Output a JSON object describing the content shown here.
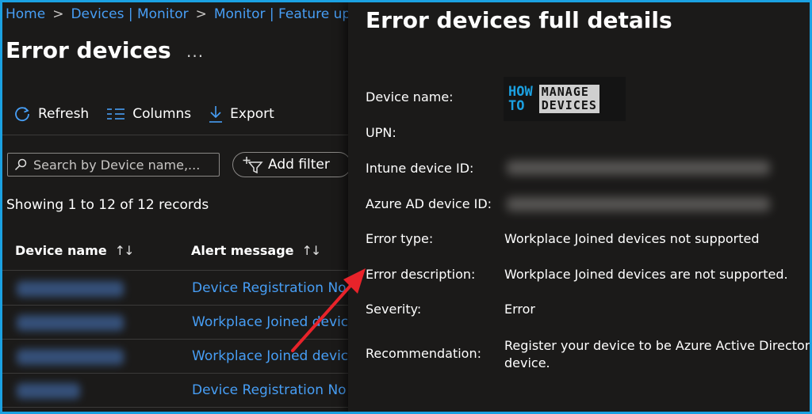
{
  "breadcrumb": {
    "items": [
      "Home",
      "Devices | Monitor",
      "Monitor | Feature up"
    ],
    "separator": ">"
  },
  "page": {
    "title": "Error devices",
    "more_label": "..."
  },
  "toolbar": {
    "refresh_label": "Refresh",
    "columns_label": "Columns",
    "export_label": "Export"
  },
  "search": {
    "placeholder": "Search by Device name,..."
  },
  "filter": {
    "add_filter_label": "Add filter"
  },
  "records": {
    "text": "Showing 1 to 12 of 12 records"
  },
  "table": {
    "columns": [
      "Device name",
      "Alert message"
    ],
    "sort_glyph": "↑↓",
    "rows": [
      {
        "alert_message": "Device Registration No T"
      },
      {
        "alert_message": "Workplace Joined device"
      },
      {
        "alert_message": "Workplace Joined device"
      },
      {
        "alert_message": "Device Registration No T"
      }
    ]
  },
  "details": {
    "title": "Error devices full details",
    "logo": {
      "left_lines": [
        "HOW",
        "TO"
      ],
      "right_lines": [
        "MANAGE",
        "DEVICES"
      ]
    },
    "fields": {
      "device_name_label": "Device name:",
      "upn_label": "UPN:",
      "intune_id_label": "Intune device ID:",
      "aad_id_label": "Azure AD device ID:",
      "error_type_label": "Error type:",
      "error_type_value": "Workplace Joined devices not supported",
      "error_desc_label": "Error description:",
      "error_desc_value": "Workplace Joined devices are not supported.",
      "severity_label": "Severity:",
      "severity_value": "Error",
      "recommendation_label": "Recommendation:",
      "recommendation_line1": "Register your device to be Azure Active Directory",
      "recommendation_line2": "device."
    }
  },
  "colors": {
    "frame_border": "#1ba1e2",
    "link": "#479ef5",
    "background": "#1b1a19",
    "annotation_arrow": "#e8232a"
  }
}
